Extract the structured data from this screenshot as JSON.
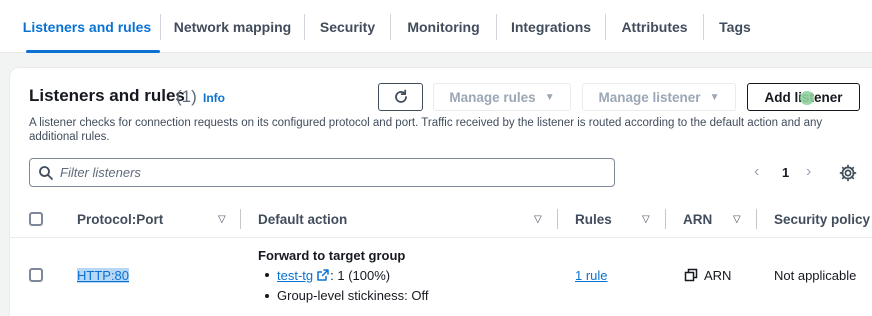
{
  "tabs": [
    {
      "label": "Listeners and rules",
      "active": true
    },
    {
      "label": "Network mapping"
    },
    {
      "label": "Security"
    },
    {
      "label": "Monitoring"
    },
    {
      "label": "Integrations"
    },
    {
      "label": "Attributes"
    },
    {
      "label": "Tags"
    }
  ],
  "panel": {
    "title": "Listeners and rules",
    "count": "(1)",
    "info": "Info",
    "description": "A listener checks for connection requests on its configured protocol and port. Traffic received by the listener is routed according to the default action and any additional rules.",
    "buttons": {
      "refresh_icon": "refresh-icon",
      "manage_rules": "Manage rules",
      "manage_listener": "Manage listener",
      "add_listener": "Add listener"
    },
    "filter": {
      "placeholder": "Filter listeners",
      "value": ""
    },
    "pagination": {
      "current_page": "1"
    }
  },
  "table": {
    "columns": [
      "Protocol:Port",
      "Default action",
      "Rules",
      "ARN",
      "Security policy"
    ],
    "rows": [
      {
        "protocol_port": "HTTP:80",
        "default_action_title": "Forward to target group",
        "target_group": "test-tg",
        "target_weight": ": 1 (100%)",
        "stickiness": "Group-level stickiness: Off",
        "rules": "1 rule",
        "arn": "ARN",
        "security_policy": "Not applicable"
      }
    ]
  },
  "colors": {
    "accent": "#0972d3",
    "text": "#16191f",
    "muted": "#5f6b7a",
    "disabled": "#9ba7b6"
  }
}
